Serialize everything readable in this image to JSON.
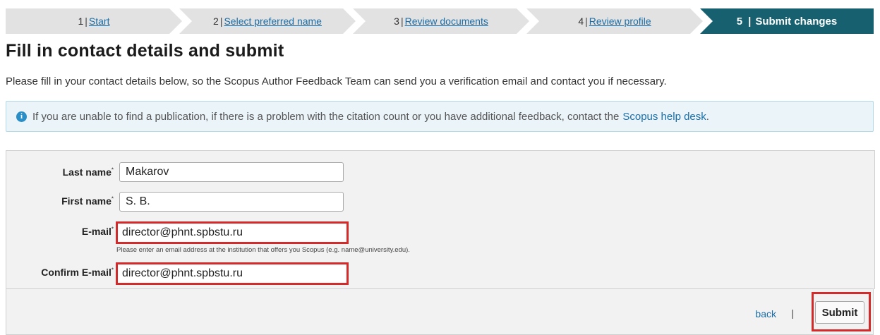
{
  "steps": [
    {
      "num": "1",
      "label": "Start"
    },
    {
      "num": "2",
      "label": "Select preferred name"
    },
    {
      "num": "3",
      "label": "Review documents"
    },
    {
      "num": "4",
      "label": "Review profile"
    },
    {
      "num": "5",
      "label": "Submit changes"
    }
  ],
  "page": {
    "title": "Fill in contact details and submit",
    "intro": "Please fill in your contact details below, so the Scopus Author Feedback Team can send you a verification email and contact you if necessary."
  },
  "info": {
    "text": "If you are unable to find a publication, if there is a problem with the citation count or you have additional feedback, contact the",
    "link": "Scopus help desk",
    "end": "."
  },
  "form": {
    "required_mark": "*",
    "last_name_label": "Last name",
    "last_name_value": "Makarov",
    "first_name_label": "First name",
    "first_name_value": "S. B.",
    "email_label": "E-mail",
    "email_value": "director@phnt.spbstu.ru",
    "email_hint": "Please enter an email address at the institution that offers you Scopus (e.g. name@university.edu).",
    "confirm_email_label": "Confirm E-mail",
    "confirm_email_value": "director@phnt.spbstu.ru"
  },
  "footer": {
    "back_label": "back",
    "separator": "|",
    "submit_label": "Submit"
  },
  "colors": {
    "active_step": "#16606f",
    "highlight": "#d12b2b",
    "link": "#1a6ea8"
  }
}
